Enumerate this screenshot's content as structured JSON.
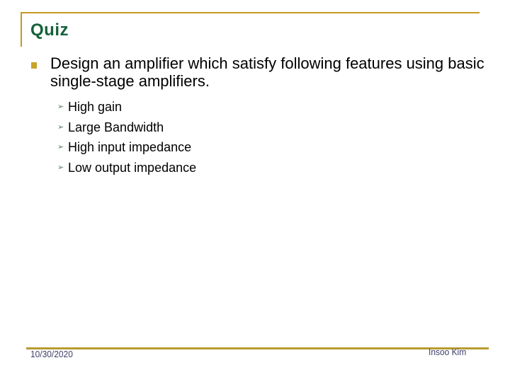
{
  "slide": {
    "title": "Quiz",
    "main_bullet": {
      "icon": "square-bullet-icon",
      "text": "Design an amplifier which satisfy following features using basic single-stage amplifiers."
    },
    "sub_bullets": [
      {
        "icon": "arrowhead-bullet-icon",
        "glyph": "➢",
        "text": "High gain"
      },
      {
        "icon": "arrowhead-bullet-icon",
        "glyph": "➢",
        "text": "Large Bandwidth"
      },
      {
        "icon": "arrowhead-bullet-icon",
        "glyph": "➢",
        "text": "High input impedance"
      },
      {
        "icon": "arrowhead-bullet-icon",
        "glyph": "➢",
        "text": "Low output impedance"
      }
    ]
  },
  "footer": {
    "date": "10/30/2020",
    "author": "Insoo Kim"
  },
  "colors": {
    "accent_rule": "#C49A22",
    "title": "#16613A",
    "bullet": "#C9A22A",
    "sub_bullet": "#5E7A5E",
    "footer_text": "#3E3E6A"
  }
}
